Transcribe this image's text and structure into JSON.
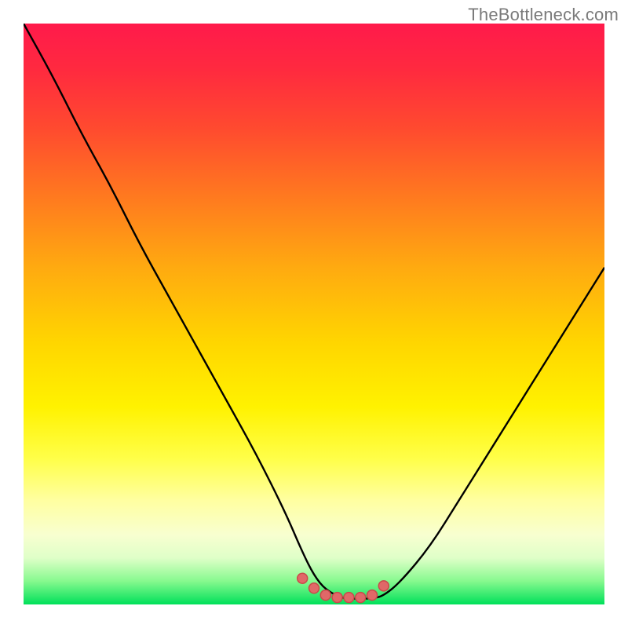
{
  "watermark": "TheBottleneck.com",
  "colors": {
    "frame": "#000000",
    "curve": "#000000",
    "marker_fill": "#e06868",
    "marker_stroke": "#c94a4a",
    "line_green": "#00e05a"
  },
  "chart_data": {
    "type": "line",
    "title": "",
    "xlabel": "",
    "ylabel": "",
    "xlim": [
      0,
      100
    ],
    "ylim": [
      0,
      100
    ],
    "series": [
      {
        "name": "bottleneck-curve",
        "x": [
          0,
          5,
          10,
          15,
          20,
          25,
          30,
          35,
          40,
          45,
          48,
          50,
          52,
          55,
          57,
          60,
          62,
          65,
          70,
          75,
          80,
          85,
          90,
          95,
          100
        ],
        "y": [
          100,
          91,
          81,
          72,
          62,
          53,
          44,
          35,
          26,
          16,
          9,
          5,
          2.5,
          1,
          1,
          1,
          1.5,
          4,
          10,
          18,
          26,
          34,
          42,
          50,
          58
        ]
      }
    ],
    "markers": {
      "name": "flat-bottom-markers",
      "x": [
        48,
        50,
        52,
        54,
        56,
        58,
        60,
        62
      ],
      "y": [
        4.5,
        2.8,
        1.6,
        1.2,
        1.2,
        1.2,
        1.6,
        3.2
      ]
    }
  }
}
